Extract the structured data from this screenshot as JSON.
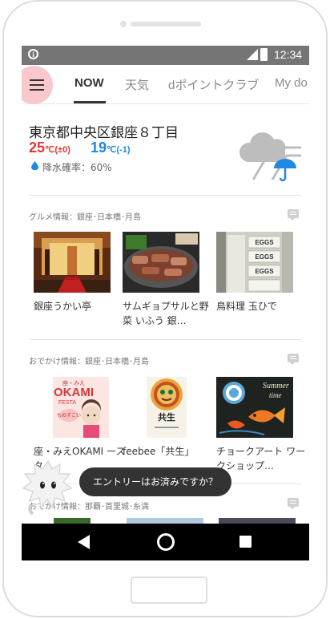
{
  "status_bar": {
    "time": "12:34",
    "info_icon": "i"
  },
  "tabs": [
    {
      "label": "NOW",
      "active": true
    },
    {
      "label": "天気",
      "active": false
    },
    {
      "label": "dポイントクラブ",
      "active": false
    },
    {
      "label": "My do",
      "active": false
    }
  ],
  "weather": {
    "location": "東京都中央区銀座８丁目",
    "high_temp": "25",
    "high_unit": "℃",
    "high_diff": "(±0)",
    "low_temp": "19",
    "low_unit": "℃",
    "low_diff": "(-1)",
    "rain_label": "降水確率：60%",
    "high_color": "#e53935",
    "low_color": "#1e88e5",
    "icon": "cloud-rain-umbrella"
  },
  "sections": [
    {
      "title": "グルメ情報：銀座･日本橋･月島",
      "cards": [
        {
          "caption": "銀座うかい亭"
        },
        {
          "caption": "サムギョプサルと野菜 いふう 銀…"
        },
        {
          "caption": "鳥料理 玉ひで"
        }
      ]
    },
    {
      "title": "おでかけ情報：銀座･日本橋･月島",
      "cards": [
        {
          "caption": "座・みえOKAMI ースタ"
        },
        {
          "caption": "feebee「共生」"
        },
        {
          "caption": "チョークアート ワークショップ…"
        }
      ]
    },
    {
      "title": "おでかけ情報：那覇･首里城･糸満",
      "cards": []
    }
  ],
  "image_text": {
    "eggs": "EGGS",
    "okami_top": "座・みえ",
    "okami_main": "OKAMI",
    "okami_sub": "FESTA",
    "okami_tag": "ものずこい",
    "kyosei": "共生",
    "summer": "Summer",
    "time_word": "time"
  },
  "toast": "エントリーはお済みですか？",
  "accent_colors": {
    "menu_highlight": "#f9c8cc",
    "statusbar": "#757575",
    "navbar": "#000000"
  }
}
